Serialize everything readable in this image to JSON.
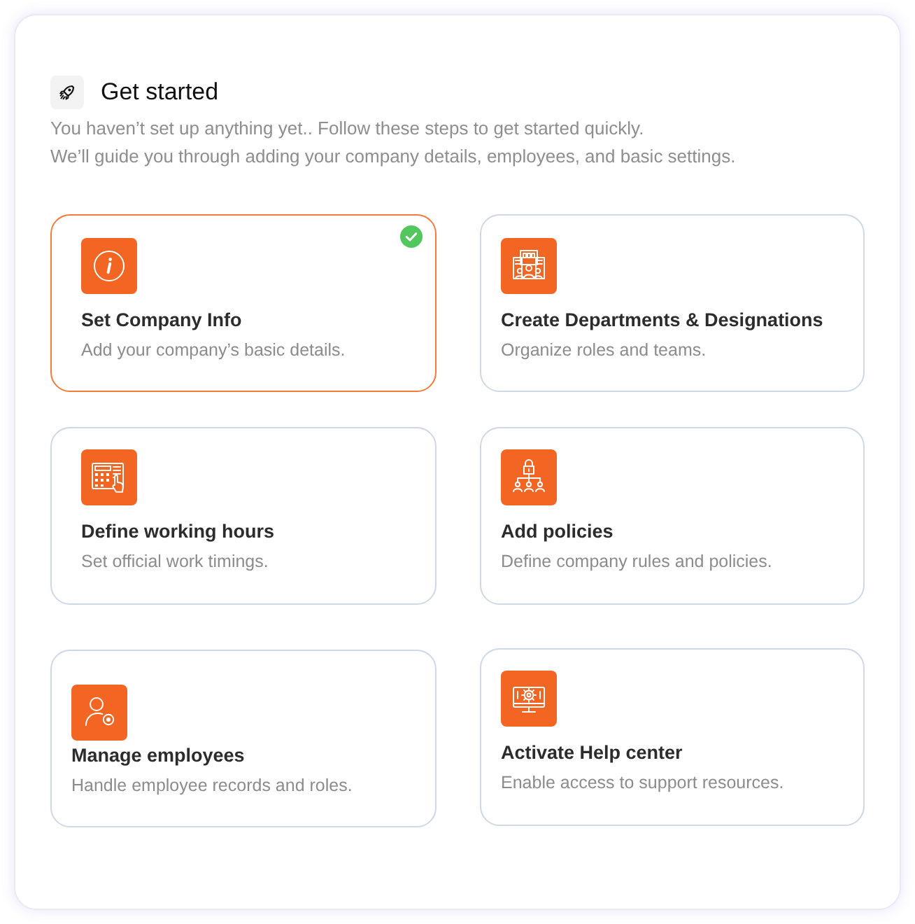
{
  "header": {
    "title": "Get started",
    "lines": [
      "You haven’t set up anything yet.. Follow these steps to get started quickly.",
      "We’ll guide you through adding your company details, employees, and basic settings."
    ]
  },
  "steps": [
    {
      "title": "Set Company Info",
      "description": "Add your company’s basic details.",
      "completed": true
    },
    {
      "title": "Create Departments & Designations",
      "description": "Organize roles and teams.",
      "completed": false
    },
    {
      "title": "Define working hours",
      "description": "Set official work timings.",
      "completed": false
    },
    {
      "title": "Add policies",
      "description": "Define company rules and policies.",
      "completed": false
    },
    {
      "title": "Manage employees",
      "description": "Handle employee records and roles.",
      "completed": false
    },
    {
      "title": "Activate Help center",
      "description": "Enable access to support resources.",
      "completed": false
    }
  ]
}
